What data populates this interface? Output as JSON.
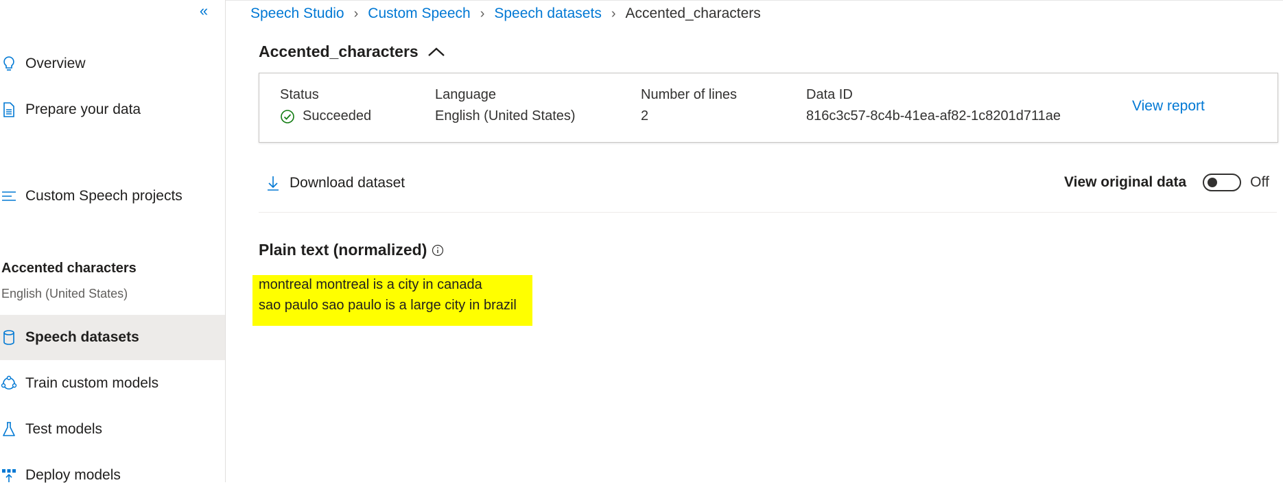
{
  "sidebar": {
    "collapse_icon": "chevron-double-left-icon",
    "items": [
      {
        "label": "Overview",
        "icon": "lightbulb-icon"
      },
      {
        "label": "Prepare your data",
        "icon": "document-icon"
      },
      {
        "label": "Custom Speech projects",
        "icon": "list-icon"
      },
      {
        "label": "Speech datasets",
        "icon": "database-icon"
      },
      {
        "label": "Train custom models",
        "icon": "model-icon"
      },
      {
        "label": "Test models",
        "icon": "flask-icon"
      },
      {
        "label": "Deploy models",
        "icon": "deploy-icon"
      }
    ],
    "project": {
      "title": "Accented characters",
      "language": "English (United States)"
    }
  },
  "breadcrumb": [
    "Speech Studio",
    "Custom Speech",
    "Speech datasets",
    "Accented_characters"
  ],
  "dataset": {
    "title": "Accented_characters",
    "status_label": "Status",
    "status_value": "Succeeded",
    "language_label": "Language",
    "language_value": "English (United States)",
    "lines_label": "Number of lines",
    "lines_value": "2",
    "dataid_label": "Data ID",
    "dataid_value": "816c3c57-8c4b-41ea-af82-1c8201d711ae",
    "view_report": "View report"
  },
  "toolbar": {
    "download_label": "Download dataset",
    "toggle_label": "View original data",
    "toggle_state": "Off"
  },
  "content": {
    "section_title": "Plain text (normalized)",
    "lines": [
      "montreal montreal is a city in canada",
      "sao paulo sao paulo is a large city in brazil"
    ],
    "highlight_color": "#ffff00"
  },
  "colors": {
    "accent": "#0078d4",
    "success": "#107c10"
  }
}
